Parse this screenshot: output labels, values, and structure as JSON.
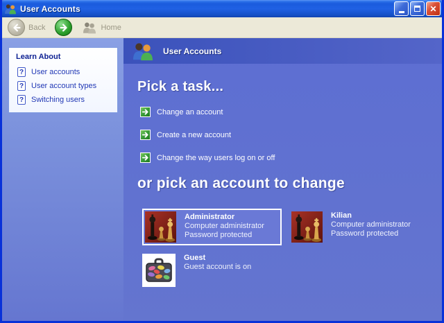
{
  "window": {
    "title": "User Accounts",
    "close_glyph": "✕"
  },
  "toolbar": {
    "back_label": "Back",
    "home_label": "Home"
  },
  "sidebar": {
    "learn_about": {
      "title": "Learn About",
      "items": [
        {
          "label": "User accounts"
        },
        {
          "label": "User account types"
        },
        {
          "label": "Switching users"
        }
      ]
    }
  },
  "main": {
    "header_title": "User Accounts",
    "pick_task_heading": "Pick a task...",
    "tasks": [
      {
        "label": "Change an account"
      },
      {
        "label": "Create a new account"
      },
      {
        "label": "Change the way users log on or off"
      }
    ],
    "pick_account_heading": "or pick an account to change",
    "accounts": [
      {
        "name": "Administrator",
        "type": "Computer administrator",
        "status": "Password protected",
        "icon": "chess-picture",
        "selected": true
      },
      {
        "name": "Kilian",
        "type": "Computer administrator",
        "status": "Password protected",
        "icon": "chess-picture",
        "selected": false
      },
      {
        "name": "Guest",
        "status": "Guest account is on",
        "icon": "suitcase-picture",
        "selected": false
      }
    ]
  },
  "colors": {
    "window_border": "#0831D9",
    "titlebar_blue": "#1C5CDD",
    "toolbar_bg": "#ECE9D8",
    "sidebar_bg": "#7B91DC",
    "main_bg": "#6273D1",
    "header_band": "#3B52BB",
    "close_red": "#DA5138",
    "forward_green": "#2DA02D",
    "link_blue": "#2138B5"
  }
}
